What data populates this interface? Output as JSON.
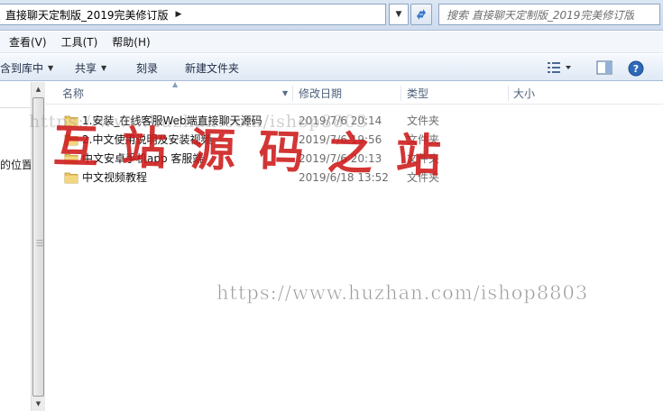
{
  "address": {
    "path": "直接聊天定制版_2019完美修订版",
    "arrow_icon": "chevron-right-icon"
  },
  "search": {
    "placeholder": "搜索 直接聊天定制版_2019完美修订版"
  },
  "menu": {
    "items": [
      "查看(V)",
      "工具(T)",
      "帮助(H)"
    ]
  },
  "toolbar": {
    "include_library": "含到库中",
    "share": "共享",
    "burn": "刻录",
    "new_folder": "新建文件夹"
  },
  "nav": {
    "places_label": "的位置"
  },
  "columns": {
    "name": "名称",
    "date": "修改日期",
    "type": "类型",
    "size": "大小"
  },
  "rows": [
    {
      "name": "1.安装_在线客服Web端直接聊天源码",
      "date": "2019/7/6 20:14",
      "type": "文件夹"
    },
    {
      "name": "2.中文使用说明及安装视频",
      "date": "2019/7/6 19:56",
      "type": "文件夹"
    },
    {
      "name": "中文安卓手机app 客服端",
      "date": "2019/7/6 20:13",
      "type": "文件夹"
    },
    {
      "name": "中文视频教程",
      "date": "2019/6/18 13:52",
      "type": "文件夹"
    }
  ],
  "watermarks": {
    "url": "https://www.huzhan.com/ishop8803",
    "url_top": "https://www.huzhan.com/ishop8803",
    "brand": "互站源码之站"
  },
  "colors": {
    "folder": "#e8c45c",
    "watermark_red": "#cd1919",
    "header_text": "#4c607a"
  }
}
